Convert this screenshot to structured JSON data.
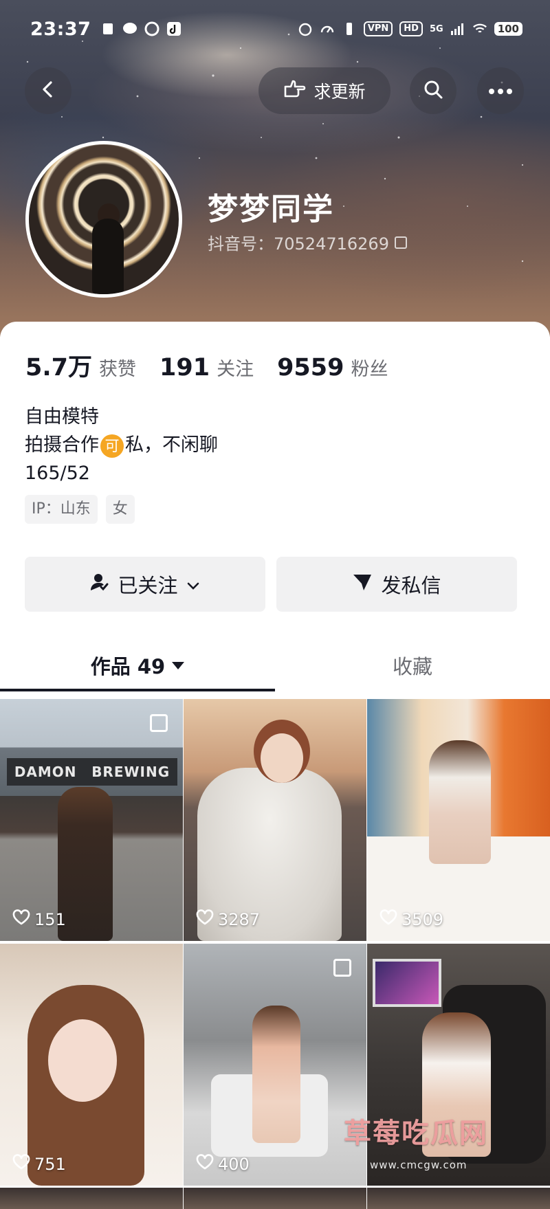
{
  "status_bar": {
    "time": "23:37",
    "vpn": "VPN",
    "hd": "HD",
    "signal": "5G",
    "battery": "100"
  },
  "header": {
    "update_button_label": "求更新"
  },
  "profile": {
    "nickname": "梦梦同学",
    "douyin_id": "抖音号：70524716269"
  },
  "stats": [
    {
      "value": "5.7万",
      "label": "获赞"
    },
    {
      "value": "191",
      "label": "关注"
    },
    {
      "value": "9559",
      "label": "粉丝"
    }
  ],
  "bio": {
    "line1": "自由模特",
    "line2_before": "拍摄合作",
    "line2_badge": "可",
    "line2_after": "私，不闲聊",
    "line3": "165/52"
  },
  "tags": [
    "IP：山东",
    "女"
  ],
  "actions": {
    "follow_label": "已关注",
    "message_label": "发私信"
  },
  "tabs": {
    "works_label": "作品 49",
    "favorites_label": "收藏"
  },
  "posts": [
    {
      "likes": "151",
      "sign_left": "DAMON",
      "sign_right": "BREWING"
    },
    {
      "likes": "3287"
    },
    {
      "likes": "3509"
    },
    {
      "likes": "751"
    },
    {
      "likes": "400"
    },
    {
      "likes": ""
    }
  ],
  "watermark": {
    "text": "草莓吃瓜网",
    "url": "www.cmcgw.com"
  },
  "colors": {
    "badge": "#f5a623",
    "text_primary": "#161823",
    "text_secondary": "#6b6c72",
    "button_bg": "#f1f1f2"
  },
  "icons": [
    "back-icon",
    "thumb-point-icon",
    "search-icon",
    "more-icon",
    "follow-user-icon",
    "chevron-down-icon",
    "send-icon",
    "heart-icon",
    "multi-image-icon",
    "copy-icon"
  ]
}
